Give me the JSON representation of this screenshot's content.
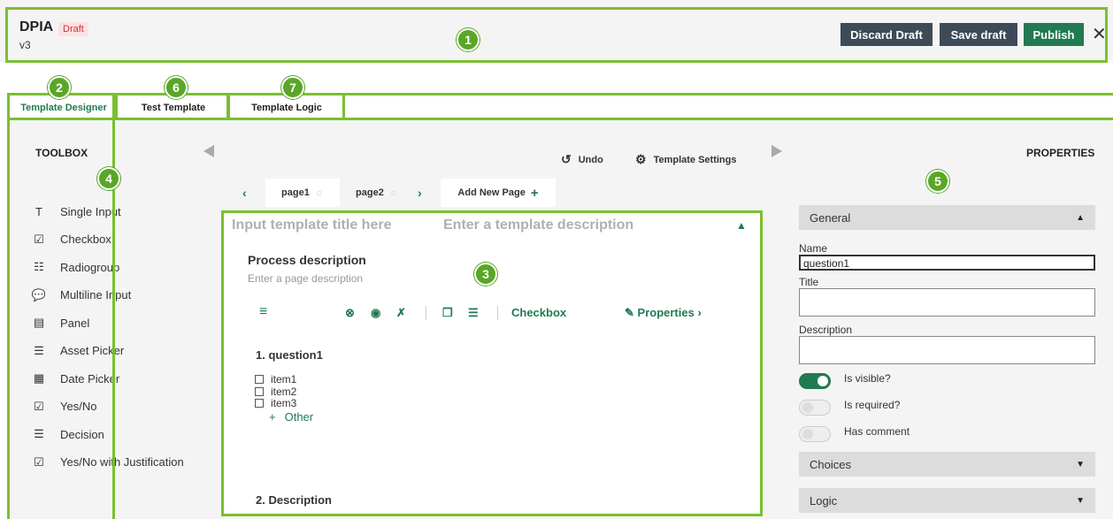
{
  "header": {
    "title": "DPIA",
    "status": "Draft",
    "version": "v3",
    "discard_label": "Discard Draft",
    "save_label": "Save draft",
    "publish_label": "Publish",
    "close_label": "✕"
  },
  "annotations": [
    "1",
    "2",
    "3",
    "4",
    "5",
    "6",
    "7"
  ],
  "tabs": [
    {
      "label": "Template Designer",
      "active": true
    },
    {
      "label": "Test Template",
      "active": false
    },
    {
      "label": "Template Logic",
      "active": false
    }
  ],
  "toolbox": {
    "title": "TOOLBOX",
    "items": [
      {
        "icon": "text-icon",
        "glyph": "T",
        "label": "Single Input"
      },
      {
        "icon": "checkbox-icon",
        "glyph": "☑",
        "label": "Checkbox"
      },
      {
        "icon": "radiogroup-icon",
        "glyph": "☷",
        "label": "Radiogroup"
      },
      {
        "icon": "comment-icon",
        "glyph": "💬",
        "label": "Multiline Input"
      },
      {
        "icon": "panel-icon",
        "glyph": "▤",
        "label": "Panel"
      },
      {
        "icon": "asset-picker-icon",
        "glyph": "☰",
        "label": "Asset Picker"
      },
      {
        "icon": "calendar-icon",
        "glyph": "▦",
        "label": "Date Picker"
      },
      {
        "icon": "yes-no-icon",
        "glyph": "☑",
        "label": "Yes/No"
      },
      {
        "icon": "decision-icon",
        "glyph": "☰",
        "label": "Decision"
      },
      {
        "icon": "yes-no-justification-icon",
        "glyph": "☑",
        "label": "Yes/No with Justification"
      }
    ]
  },
  "designer": {
    "undo_label": "Undo",
    "settings_label": "Template Settings",
    "pages": [
      {
        "label": "page1",
        "active": true
      },
      {
        "label": "page2",
        "active": false
      }
    ],
    "add_page_label": "Add New Page",
    "title_placeholder": "Input template title here",
    "description_placeholder": "Enter a template description",
    "page_title": "Process description",
    "page_description": "Enter a page description",
    "question_type": "Checkbox",
    "properties_label": "Properties",
    "question1_title": "1. question1",
    "choices": [
      "item1",
      "item2",
      "item3"
    ],
    "other_label": "Other",
    "question2_title": "2. Description"
  },
  "properties": {
    "title": "PROPERTIES",
    "general_label": "General",
    "name_label": "Name",
    "name_value": "question1",
    "title_label": "Title",
    "description_label": "Description",
    "visible_label": "Is visible?",
    "required_label": "Is required?",
    "comment_label": "Has comment",
    "choices_label": "Choices",
    "logic_label": "Logic"
  },
  "colors": {
    "accent": "#217a52",
    "highlight": "#7ac030",
    "badge": "#5aa628",
    "dark_button": "#3d4a57"
  }
}
